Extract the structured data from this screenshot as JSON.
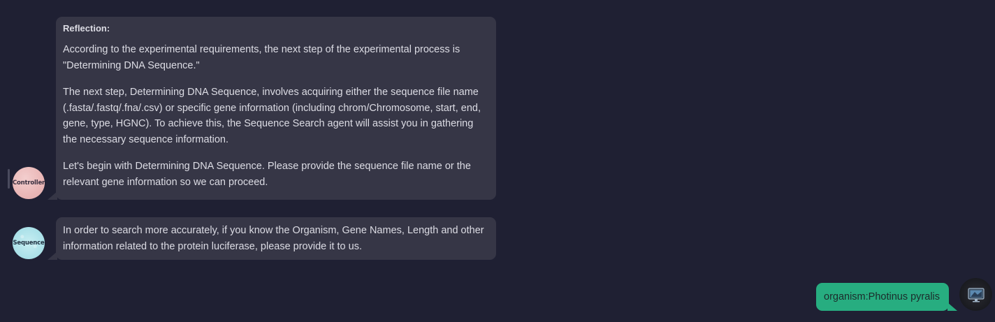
{
  "messages": [
    {
      "sender": "Controller",
      "heading": "Reflection:",
      "paragraphs": [
        "According to the experimental requirements, the next step of the experimental process is \"Determining DNA Sequence.\"",
        "The next step, Determining DNA Sequence, involves acquiring either the sequence file name (.fasta/.fastq/.fna/.csv) or specific gene information (including chrom/Chromosome, start, end, gene, type, HGNC). To achieve this, the Sequence Search agent will assist you in gathering the necessary sequence information.",
        "Let's begin with Determining DNA Sequence. Please provide the sequence file name or the relevant gene information so we can proceed."
      ]
    },
    {
      "sender": "Sequence",
      "paragraphs": [
        "In order to search more accurately, if you know the Organism, Gene Names, Length and other information related to the protein luciferase, please provide it to us."
      ]
    },
    {
      "sender": "user",
      "text": "organism:Photinus pyralis"
    }
  ],
  "avatars": {
    "controller": {
      "label": "Controller",
      "color": "#eab7b7"
    },
    "sequence": {
      "label": "Sequence",
      "color": "#a9e0e8"
    },
    "user": {
      "icon": "monitor-icon"
    }
  },
  "colors": {
    "background": "#1f2033",
    "agent_bubble": "#363646",
    "user_bubble": "#27ad80"
  }
}
